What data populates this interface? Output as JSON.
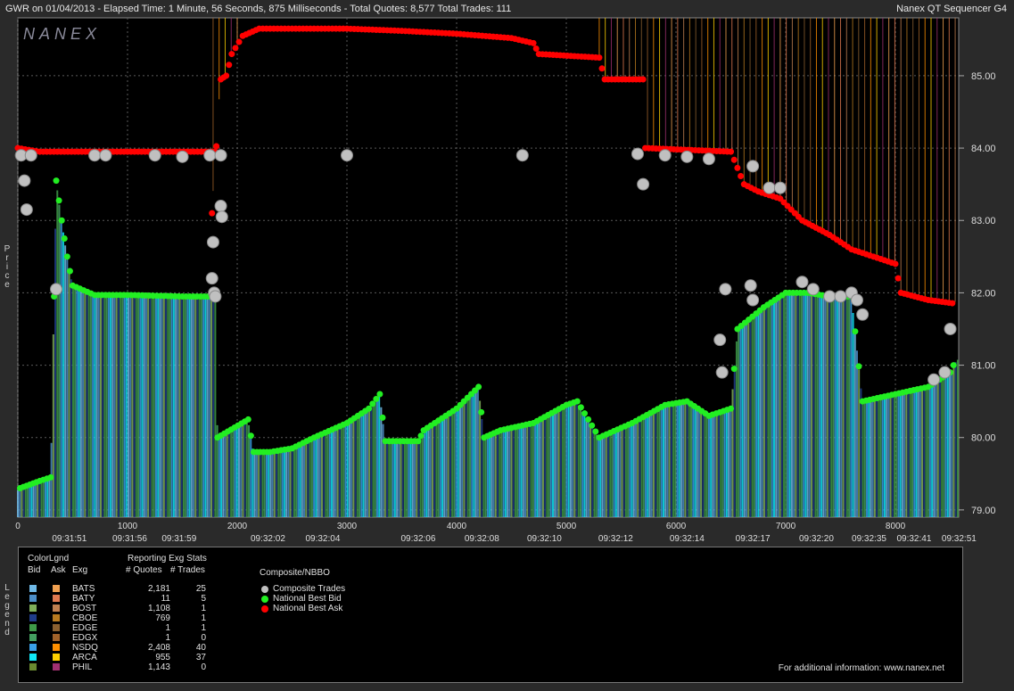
{
  "header": {
    "title": "GWR on 01/04/2013  -  Elapsed Time: 1 Minute, 56 Seconds, 875 Milliseconds  -  Total Quotes: 8,577  Total Trades: 111",
    "app": "Nanex QT Sequencer G4",
    "logo": "NANEX"
  },
  "side_labels": {
    "price": "Price",
    "legend": "Legend"
  },
  "colors": {
    "bid": "#22ee22",
    "ask": "#ff0000",
    "trade": "#c0c0c0",
    "grid": "#5a5a5a",
    "background": "#000000"
  },
  "chart_data": {
    "type": "scatter",
    "title": "GWR on 01/04/2013",
    "ylabel": "Price",
    "ylim": [
      78.9,
      85.8
    ],
    "xlim": [
      0,
      8577
    ],
    "yticks": [
      "79.00",
      "80.00",
      "81.00",
      "82.00",
      "83.00",
      "84.00",
      "85.00"
    ],
    "xticks": [
      "0",
      "1000",
      "2000",
      "3000",
      "4000",
      "5000",
      "6000",
      "7000",
      "8000"
    ],
    "time_labels": [
      {
        "x": 470,
        "label": "09:31:51"
      },
      {
        "x": 1020,
        "label": "09:31:56"
      },
      {
        "x": 1470,
        "label": "09:31:59"
      },
      {
        "x": 2280,
        "label": "09:32:02"
      },
      {
        "x": 2780,
        "label": "09:32:04"
      },
      {
        "x": 3650,
        "label": "09:32:06"
      },
      {
        "x": 4230,
        "label": "09:32:08"
      },
      {
        "x": 4800,
        "label": "09:32:10"
      },
      {
        "x": 5450,
        "label": "09:32:12"
      },
      {
        "x": 6100,
        "label": "09:32:14"
      },
      {
        "x": 6700,
        "label": "09:32:17"
      },
      {
        "x": 7280,
        "label": "09:32:20"
      },
      {
        "x": 7760,
        "label": "09:32:35"
      },
      {
        "x": 8170,
        "label": "09:32:41"
      },
      {
        "x": 8580,
        "label": "09:32:51"
      }
    ],
    "series": [
      {
        "name": "National Best Ask",
        "points": [
          [
            0,
            84.0
          ],
          [
            200,
            83.95
          ],
          [
            1000,
            83.95
          ],
          [
            1800,
            83.95
          ],
          [
            1770,
            83.1
          ],
          [
            1850,
            84.95
          ],
          [
            1900,
            85.0
          ],
          [
            1950,
            85.3
          ],
          [
            2050,
            85.55
          ],
          [
            2200,
            85.65
          ],
          [
            2500,
            85.65
          ],
          [
            3000,
            85.65
          ],
          [
            3500,
            85.62
          ],
          [
            4000,
            85.58
          ],
          [
            4500,
            85.52
          ],
          [
            4700,
            85.45
          ],
          [
            4750,
            85.3
          ],
          [
            5300,
            85.25
          ],
          [
            5350,
            84.95
          ],
          [
            5700,
            84.95
          ],
          [
            5720,
            84.0
          ],
          [
            6500,
            83.95
          ],
          [
            6620,
            83.5
          ],
          [
            6750,
            83.4
          ],
          [
            6950,
            83.3
          ],
          [
            7150,
            83.0
          ],
          [
            7400,
            82.8
          ],
          [
            7600,
            82.6
          ],
          [
            7800,
            82.5
          ],
          [
            8000,
            82.4
          ],
          [
            8050,
            82.0
          ],
          [
            8300,
            81.9
          ],
          [
            8550,
            81.85
          ]
        ]
      },
      {
        "name": "National Best Bid",
        "points": [
          [
            20,
            79.3
          ],
          [
            200,
            79.4
          ],
          [
            300,
            79.45
          ],
          [
            330,
            81.95
          ],
          [
            350,
            83.55
          ],
          [
            400,
            83.0
          ],
          [
            450,
            82.5
          ],
          [
            500,
            82.1
          ],
          [
            700,
            81.97
          ],
          [
            1000,
            81.97
          ],
          [
            1500,
            81.95
          ],
          [
            1800,
            81.95
          ],
          [
            1820,
            80.0
          ],
          [
            2100,
            80.25
          ],
          [
            2150,
            79.8
          ],
          [
            2300,
            79.8
          ],
          [
            2500,
            79.85
          ],
          [
            2700,
            80.0
          ],
          [
            3000,
            80.2
          ],
          [
            3200,
            80.4
          ],
          [
            3300,
            80.6
          ],
          [
            3350,
            79.95
          ],
          [
            3650,
            79.95
          ],
          [
            3700,
            80.1
          ],
          [
            4000,
            80.4
          ],
          [
            4200,
            80.7
          ],
          [
            4250,
            80.0
          ],
          [
            4400,
            80.1
          ],
          [
            4700,
            80.2
          ],
          [
            5000,
            80.45
          ],
          [
            5100,
            80.5
          ],
          [
            5300,
            80.0
          ],
          [
            5600,
            80.2
          ],
          [
            5900,
            80.45
          ],
          [
            6100,
            80.5
          ],
          [
            6300,
            80.3
          ],
          [
            6500,
            80.4
          ],
          [
            6560,
            81.5
          ],
          [
            6800,
            81.8
          ],
          [
            7000,
            82.0
          ],
          [
            7200,
            82.0
          ],
          [
            7400,
            81.95
          ],
          [
            7600,
            81.95
          ],
          [
            7700,
            80.5
          ],
          [
            8000,
            80.6
          ],
          [
            8300,
            80.7
          ],
          [
            8500,
            80.9
          ],
          [
            8560,
            81.1
          ]
        ]
      },
      {
        "name": "Composite Trades",
        "points": [
          [
            30,
            83.9
          ],
          [
            60,
            83.55
          ],
          [
            80,
            83.15
          ],
          [
            120,
            83.9
          ],
          [
            350,
            82.05
          ],
          [
            700,
            83.9
          ],
          [
            800,
            83.9
          ],
          [
            1250,
            83.9
          ],
          [
            1500,
            83.88
          ],
          [
            1750,
            83.9
          ],
          [
            1770,
            82.2
          ],
          [
            1790,
            82.0
          ],
          [
            1800,
            81.95
          ],
          [
            1850,
            83.9
          ],
          [
            1850,
            83.2
          ],
          [
            1860,
            83.05
          ],
          [
            1780,
            82.7
          ],
          [
            3000,
            83.9
          ],
          [
            4600,
            83.9
          ],
          [
            5650,
            83.92
          ],
          [
            5700,
            83.5
          ],
          [
            5900,
            83.9
          ],
          [
            6100,
            83.88
          ],
          [
            6300,
            83.85
          ],
          [
            6400,
            81.35
          ],
          [
            6420,
            80.9
          ],
          [
            6450,
            82.05
          ],
          [
            6680,
            82.1
          ],
          [
            6700,
            81.9
          ],
          [
            6700,
            83.75
          ],
          [
            6850,
            83.45
          ],
          [
            6950,
            83.45
          ],
          [
            7150,
            82.15
          ],
          [
            7250,
            82.05
          ],
          [
            7400,
            81.95
          ],
          [
            7500,
            81.95
          ],
          [
            7600,
            82.0
          ],
          [
            7650,
            81.9
          ],
          [
            7700,
            81.7
          ],
          [
            8350,
            80.8
          ],
          [
            8450,
            80.9
          ],
          [
            8500,
            81.5
          ]
        ]
      }
    ],
    "exchanges": [
      {
        "exg": "BATS",
        "bid_color": "#6fb9e6",
        "ask_color": "#f0a050",
        "quotes": "2,181",
        "trades": "25"
      },
      {
        "exg": "BATY",
        "bid_color": "#4c8ec8",
        "ask_color": "#e07a50",
        "quotes": "11",
        "trades": "5"
      },
      {
        "exg": "BOST",
        "bid_color": "#7fae5a",
        "ask_color": "#c08050",
        "quotes": "1,108",
        "trades": "1"
      },
      {
        "exg": "CBOE",
        "bid_color": "#203c8a",
        "ask_color": "#b87a20",
        "quotes": "769",
        "trades": "1"
      },
      {
        "exg": "EDGE",
        "bid_color": "#3f9a48",
        "ask_color": "#8a6030",
        "quotes": "1",
        "trades": "1"
      },
      {
        "exg": "EDGX",
        "bid_color": "#44a060",
        "ask_color": "#a0622a",
        "quotes": "1",
        "trades": "0"
      },
      {
        "exg": "NSDQ",
        "bid_color": "#3aa0e8",
        "ask_color": "#ff9000",
        "quotes": "2,408",
        "trades": "40"
      },
      {
        "exg": "ARCA",
        "bid_color": "#10e8f8",
        "ask_color": "#ffd000",
        "quotes": "955",
        "trades": "37"
      },
      {
        "exg": "PHIL",
        "bid_color": "#6a8a30",
        "ask_color": "#a03070",
        "quotes": "1,143",
        "trades": "0"
      }
    ]
  },
  "legend": {
    "col_color": "ColorLgnd",
    "col_bid": "Bid",
    "col_ask": "Ask",
    "col_exg": "Exg",
    "col_stats": "Reporting Exg Stats",
    "col_quotes": "# Quotes",
    "col_trades": "# Trades",
    "composite_title": "Composite/NBBO",
    "composite_items": [
      "Composite Trades",
      "National Best Bid",
      "National Best Ask"
    ],
    "info": "For additional information: www.nanex.net"
  }
}
